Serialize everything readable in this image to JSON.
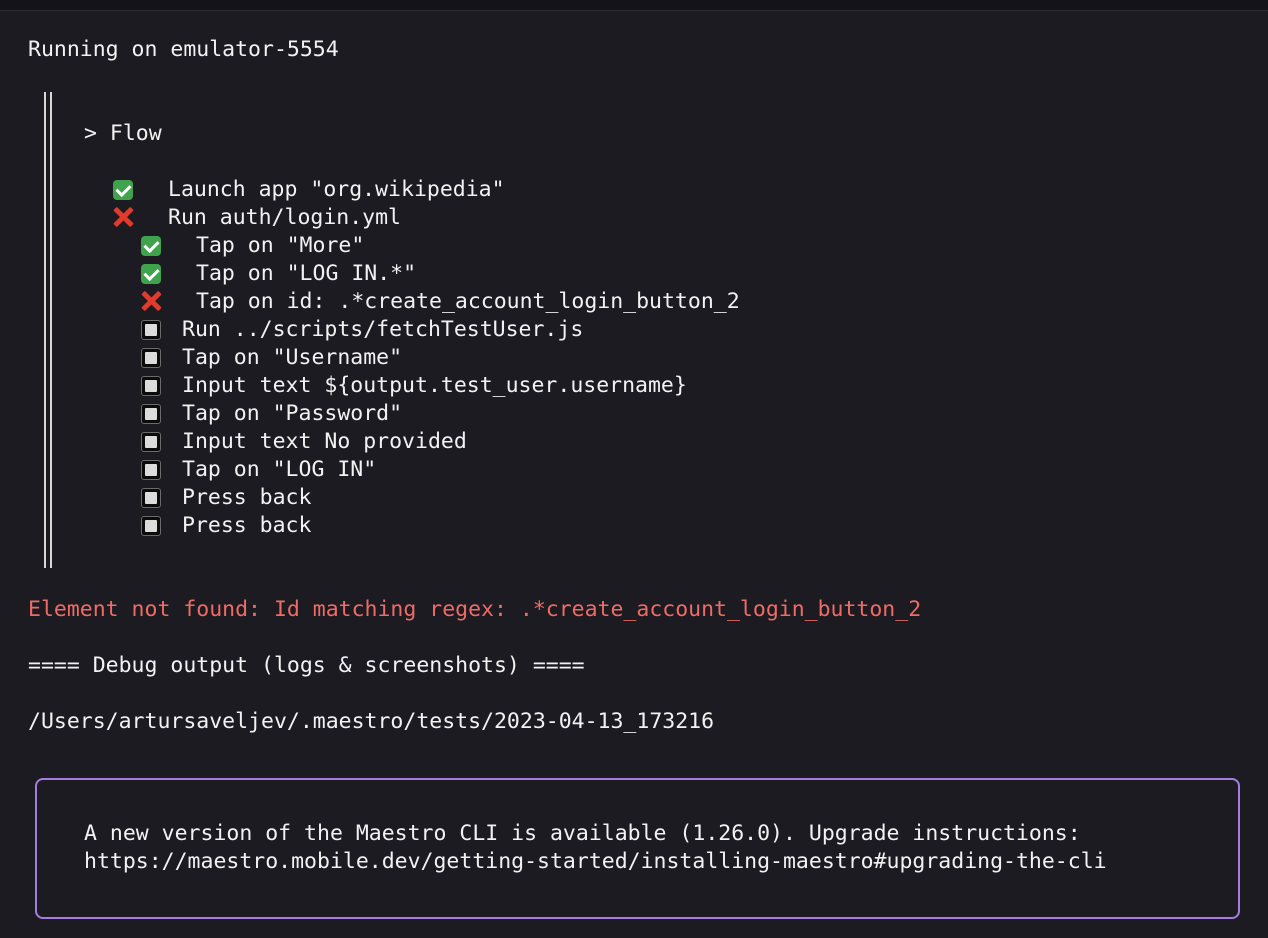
{
  "header": {
    "running_on": "Running on emulator-5554"
  },
  "flow": {
    "title": "> Flow",
    "steps": [
      {
        "status": "passed",
        "status_icon": "check-icon",
        "label": "Launch app \"org.wikipedia\""
      },
      {
        "status": "failed",
        "status_icon": "cross-icon",
        "label": "Run auth/login.yml"
      },
      {
        "status": "passed",
        "status_icon": "check-icon",
        "label": "Tap on \"More\""
      },
      {
        "status": "passed",
        "status_icon": "check-icon",
        "label": "Tap on \"LOG IN.*\""
      },
      {
        "status": "failed",
        "status_icon": "cross-icon",
        "label": "Tap on id: .*create_account_login_button_2"
      },
      {
        "status": "pending",
        "status_icon": "square-icon",
        "label": "Run ../scripts/fetchTestUser.js"
      },
      {
        "status": "pending",
        "status_icon": "square-icon",
        "label": "Tap on \"Username\""
      },
      {
        "status": "pending",
        "status_icon": "square-icon",
        "label": "Input text ${output.test_user.username}"
      },
      {
        "status": "pending",
        "status_icon": "square-icon",
        "label": "Tap on \"Password\""
      },
      {
        "status": "pending",
        "status_icon": "square-icon",
        "label": "Input text No provided"
      },
      {
        "status": "pending",
        "status_icon": "square-icon",
        "label": "Tap on \"LOG IN\""
      },
      {
        "status": "pending",
        "status_icon": "square-icon",
        "label": "Press back"
      },
      {
        "status": "pending",
        "status_icon": "square-icon",
        "label": "Press back"
      }
    ]
  },
  "error": {
    "message": "Element not found: Id matching regex: .*create_account_login_button_2"
  },
  "debug": {
    "heading": "==== Debug output (logs & screenshots) ====",
    "path": "/Users/artursaveljev/.maestro/tests/2023-04-13_173216"
  },
  "update_notice": {
    "line1": "A new version of the Maestro CLI is available (1.26.0). Upgrade instructions:",
    "line2": "https://maestro.mobile.dev/getting-started/installing-maestro#upgrading-the-cli"
  },
  "colors": {
    "background": "#1c1b22",
    "text": "#f2f2f2",
    "error": "#ef6b65",
    "pass": "#3fa34d",
    "fail": "#e23b2e",
    "box_border": "#a57de0"
  }
}
